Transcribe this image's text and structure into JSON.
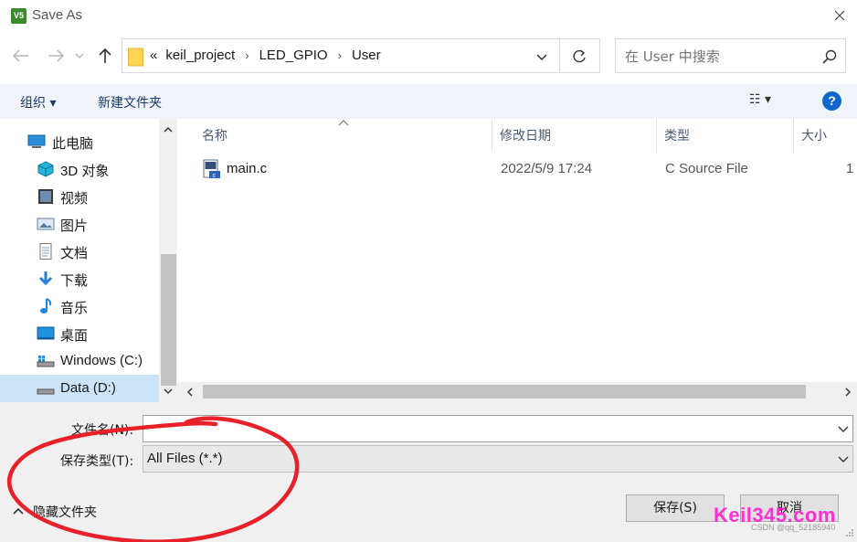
{
  "window": {
    "title": "Save As",
    "app_icon_text": "V5"
  },
  "address_bar": {
    "overflow": "«",
    "breadcrumbs": [
      "keil_project",
      "LED_GPIO",
      "User"
    ],
    "separator": "›"
  },
  "search": {
    "placeholder": "在 User 中搜索"
  },
  "toolbar": {
    "organize_label": "组织 ▾",
    "new_folder_label": "新建文件夹",
    "view_label": "☷ ▾",
    "help_label": "?"
  },
  "nav_pane": {
    "items": [
      {
        "label": "此电脑",
        "icon": "computer-icon"
      },
      {
        "label": "3D 对象",
        "icon": "cube-icon"
      },
      {
        "label": "视频",
        "icon": "video-icon"
      },
      {
        "label": "图片",
        "icon": "picture-icon"
      },
      {
        "label": "文档",
        "icon": "document-icon"
      },
      {
        "label": "下载",
        "icon": "download-icon"
      },
      {
        "label": "音乐",
        "icon": "music-icon"
      },
      {
        "label": "桌面",
        "icon": "desktop-icon"
      },
      {
        "label": "Windows (C:)",
        "icon": "drive-c-icon"
      },
      {
        "label": "Data (D:)",
        "icon": "drive-d-icon",
        "selected": true
      }
    ]
  },
  "file_list": {
    "columns": {
      "name": "名称",
      "modified": "修改日期",
      "type": "类型",
      "size": "大小"
    },
    "rows": [
      {
        "name": "main.c",
        "modified": "2022/5/9 17:24",
        "type": "C Source File",
        "size": "1"
      }
    ]
  },
  "bottom": {
    "filename_label": "文件名(N):",
    "filename_value": "",
    "filetype_label": "保存类型(T):",
    "filetype_value": "All Files (*.*)",
    "hide_folders_label": "隐藏文件夹",
    "save_label": "保存(S)",
    "cancel_label": "取消"
  },
  "watermark": {
    "brand": "Keil345.com",
    "credit": "CSDN @qq_52185940"
  },
  "colors": {
    "annotation": "#e8202a",
    "toolbar_bg": "#f0f4f9",
    "selected_bg": "#cce4f7",
    "help_blue": "#1166cc",
    "watermark": "#ff2fd0"
  }
}
